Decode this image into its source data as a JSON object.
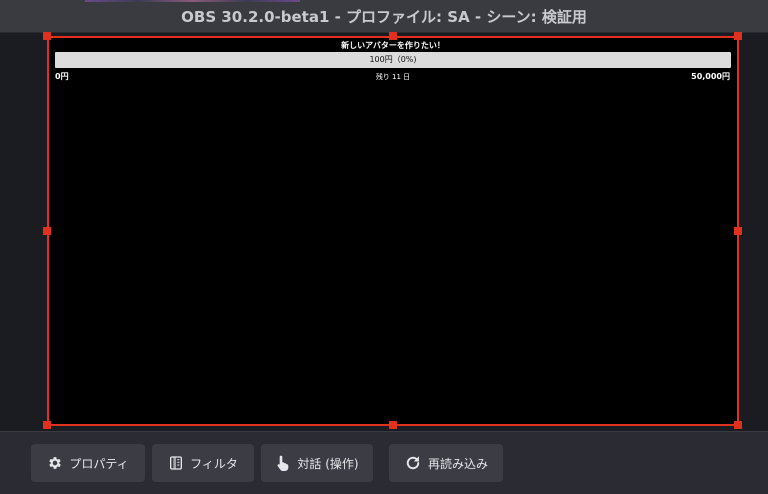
{
  "window": {
    "title": "OBS 30.2.0-beta1 - プロファイル: SA - シーン: 検証用"
  },
  "goal": {
    "title": "新しいアバターを作りたい！",
    "progress_text": "100円（0%)",
    "progress_fraction": 0.0,
    "min_label": "0円",
    "remaining_label": "残り 11 日",
    "max_label": "50,000円"
  },
  "toolbar": {
    "properties_label": "プロパティ",
    "filters_label": "フィルタ",
    "interact_label": "対話 (操作)",
    "refresh_label": "再読み込み"
  },
  "icons": {
    "properties": "gear-icon",
    "filters": "filter-icon",
    "interact": "pointer-hand-icon",
    "refresh": "refresh-icon"
  },
  "colors": {
    "selection": "#e0301e",
    "progress_track": "#dcdcdc",
    "canvas": "#000000"
  }
}
